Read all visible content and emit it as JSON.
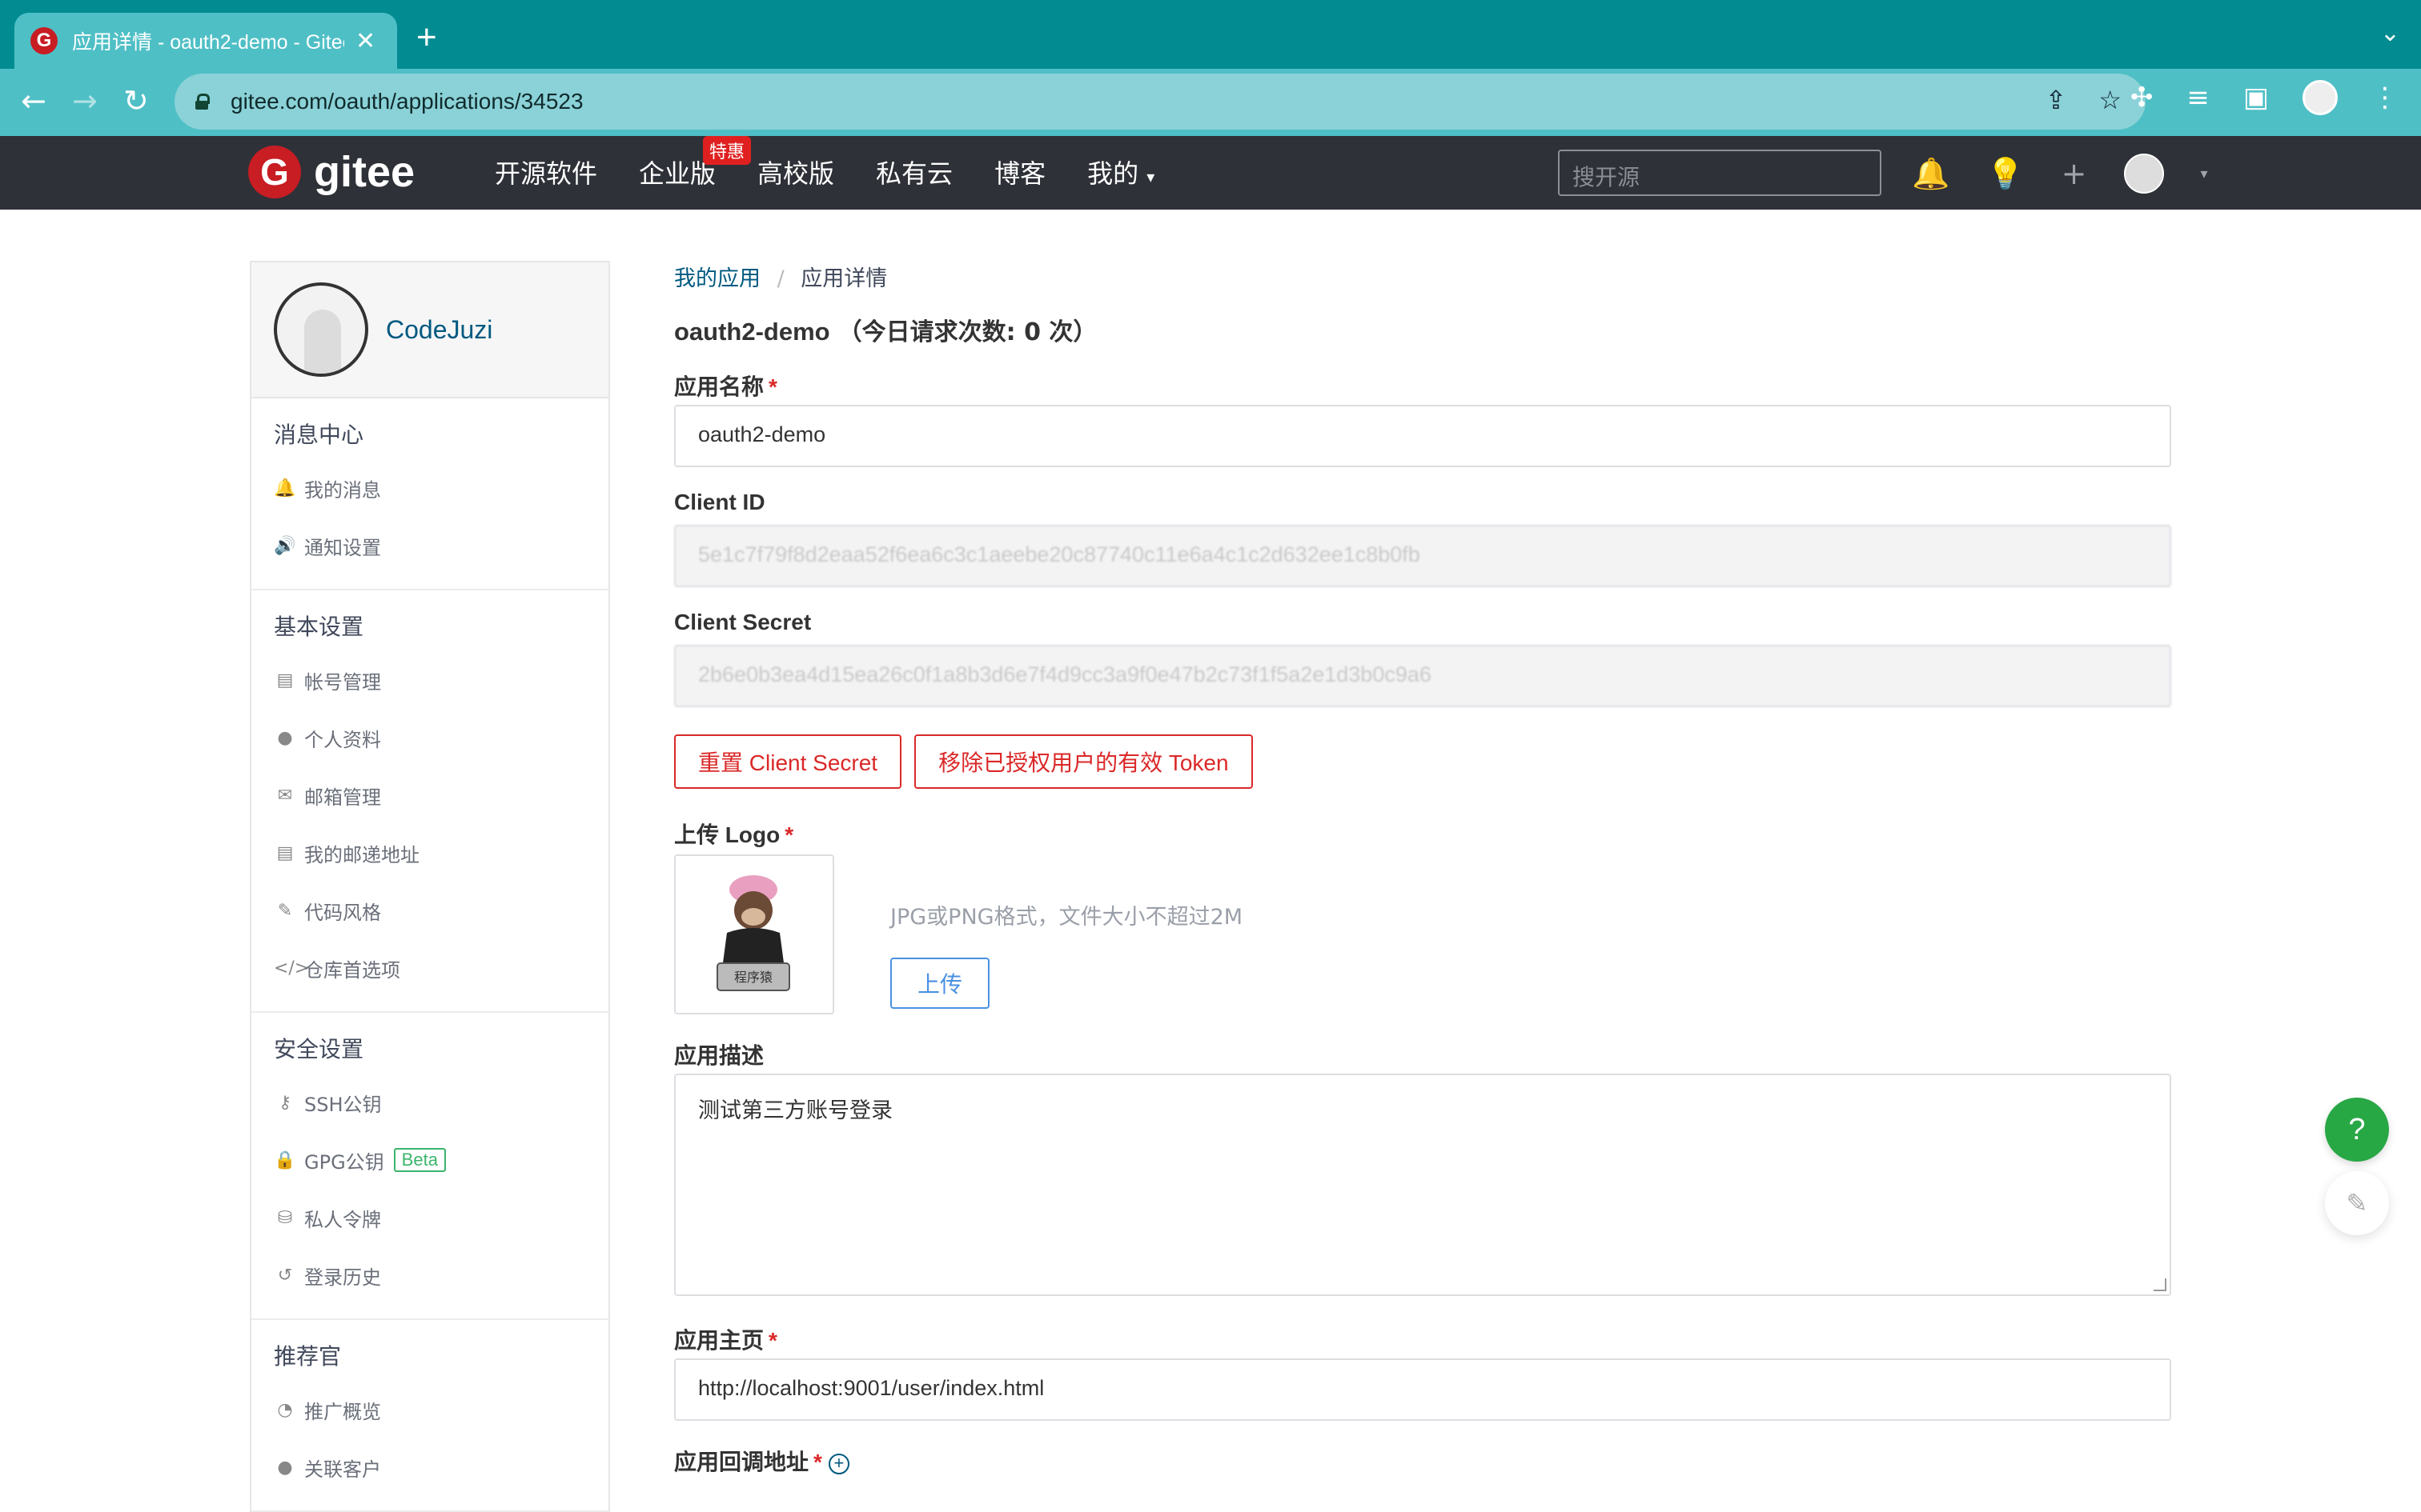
{
  "browser": {
    "tab_title": "应用详情 - oauth2-demo - Gitee",
    "url": "gitee.com/oauth/applications/34523"
  },
  "header": {
    "logo_text": "gitee",
    "nav": [
      "开源软件",
      "企业版",
      "高校版",
      "私有云",
      "博客",
      "我的"
    ],
    "hot_badge": "特惠",
    "search_placeholder": "搜开源"
  },
  "sidebar": {
    "username": "CodeJuzi",
    "sections": [
      {
        "title": "消息中心",
        "items": [
          {
            "icon": "bell-icon",
            "glyph": "🔔",
            "label": "我的消息"
          },
          {
            "icon": "speaker-icon",
            "glyph": "🔊",
            "label": "通知设置"
          }
        ]
      },
      {
        "title": "基本设置",
        "items": [
          {
            "icon": "id-card-icon",
            "glyph": "▤",
            "label": "帐号管理"
          },
          {
            "icon": "user-icon",
            "glyph": "●",
            "label": "个人资料"
          },
          {
            "icon": "envelope-icon",
            "glyph": "✉",
            "label": "邮箱管理"
          },
          {
            "icon": "address-card-icon",
            "glyph": "▤",
            "label": "我的邮递地址"
          },
          {
            "icon": "brush-icon",
            "glyph": "✎",
            "label": "代码风格"
          },
          {
            "icon": "code-icon",
            "glyph": "</>",
            "label": "仓库首选项"
          }
        ]
      },
      {
        "title": "安全设置",
        "items": [
          {
            "icon": "key-icon",
            "glyph": "⚷",
            "label": "SSH公钥"
          },
          {
            "icon": "lock-icon",
            "glyph": "🔒",
            "label": "GPG公钥",
            "badge": "Beta"
          },
          {
            "icon": "token-icon",
            "glyph": "⛁",
            "label": "私人令牌"
          },
          {
            "icon": "history-icon",
            "glyph": "↺",
            "label": "登录历史"
          }
        ]
      },
      {
        "title": "推荐官",
        "items": [
          {
            "icon": "chart-icon",
            "glyph": "◔",
            "label": "推广概览"
          },
          {
            "icon": "user-link-icon",
            "glyph": "●",
            "label": "关联客户"
          }
        ]
      }
    ]
  },
  "main": {
    "breadcrumb": {
      "parent": "我的应用",
      "sep": "/",
      "current": "应用详情"
    },
    "app_name": "oauth2-demo",
    "request_count": "（今日请求次数: 0 次）",
    "labels": {
      "name": "应用名称",
      "client_id": "Client ID",
      "client_secret": "Client Secret",
      "logo": "上传 Logo",
      "desc": "应用描述",
      "homepage": "应用主页",
      "callback": "应用回调地址",
      "required": "*"
    },
    "values": {
      "name": "oauth2-demo",
      "client_id": "5e1c7f79f8d2eaa52f6ea6c3c1aeebe20c87740c11e6a4c1c2d632ee1c8b0fb",
      "client_secret": "2b6e0b3ea4d15ea26c0f1a8b3d6e7f4d9cc3a9f0e47b2c73f1f5a2e1d3b0c9a6",
      "desc": "测试第三方账号登录",
      "homepage": "http://localhost:9001/user/index.html"
    },
    "buttons": {
      "reset_secret": "重置 Client Secret",
      "revoke_tokens": "移除已授权用户的有效 Token",
      "upload": "上传"
    },
    "logo_hint": "JPG或PNG格式，文件大小不超过2M",
    "logo_caption": "程序猿"
  },
  "floating": {
    "help": "?"
  }
}
